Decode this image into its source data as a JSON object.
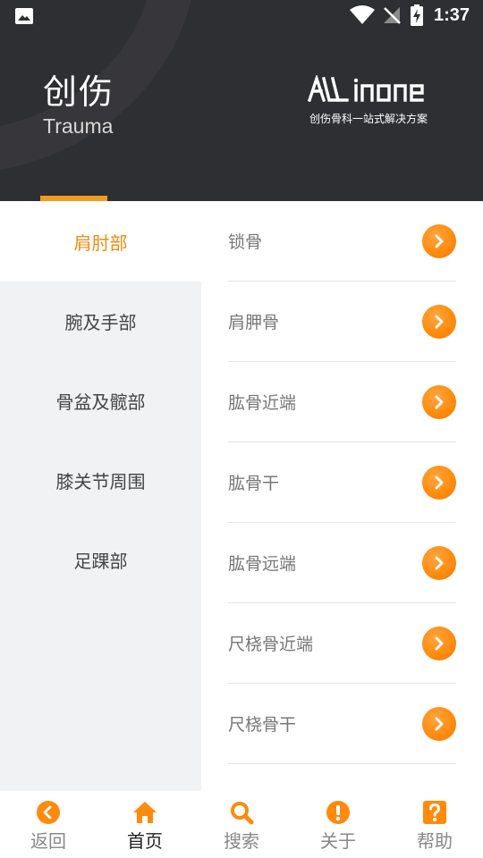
{
  "status_bar": {
    "time": "1:37",
    "icons": [
      "image-icon",
      "wifi-icon",
      "signal-off-icon",
      "battery-charging-icon"
    ]
  },
  "header": {
    "title_cn": "创伤",
    "title_en": "Trauma",
    "brand_sub": "创伤骨科一站式解决方案",
    "brand_logo_text": "ALL in ONE"
  },
  "colors": {
    "accent": "#f29a1a",
    "accent_text": "#f08a10",
    "header_bg": "#2e2f33",
    "sidebar_bg": "#f1f2f4"
  },
  "sidebar": {
    "items": [
      {
        "label": "肩肘部",
        "active": true
      },
      {
        "label": "腕及手部",
        "active": false
      },
      {
        "label": "骨盆及髋部",
        "active": false
      },
      {
        "label": "膝关节周围",
        "active": false
      },
      {
        "label": "足踝部",
        "active": false
      }
    ]
  },
  "list": {
    "items": [
      {
        "label": "锁骨"
      },
      {
        "label": "肩胛骨"
      },
      {
        "label": "肱骨近端"
      },
      {
        "label": "肱骨干"
      },
      {
        "label": "肱骨远端"
      },
      {
        "label": "尺桡骨近端"
      },
      {
        "label": "尺桡骨干"
      }
    ]
  },
  "bottom_nav": {
    "items": [
      {
        "label": "返回",
        "icon": "back-icon",
        "active": false
      },
      {
        "label": "首页",
        "icon": "home-icon",
        "active": true
      },
      {
        "label": "搜索",
        "icon": "search-icon",
        "active": false
      },
      {
        "label": "关于",
        "icon": "info-icon",
        "active": false
      },
      {
        "label": "帮助",
        "icon": "help-icon",
        "active": false
      }
    ]
  }
}
